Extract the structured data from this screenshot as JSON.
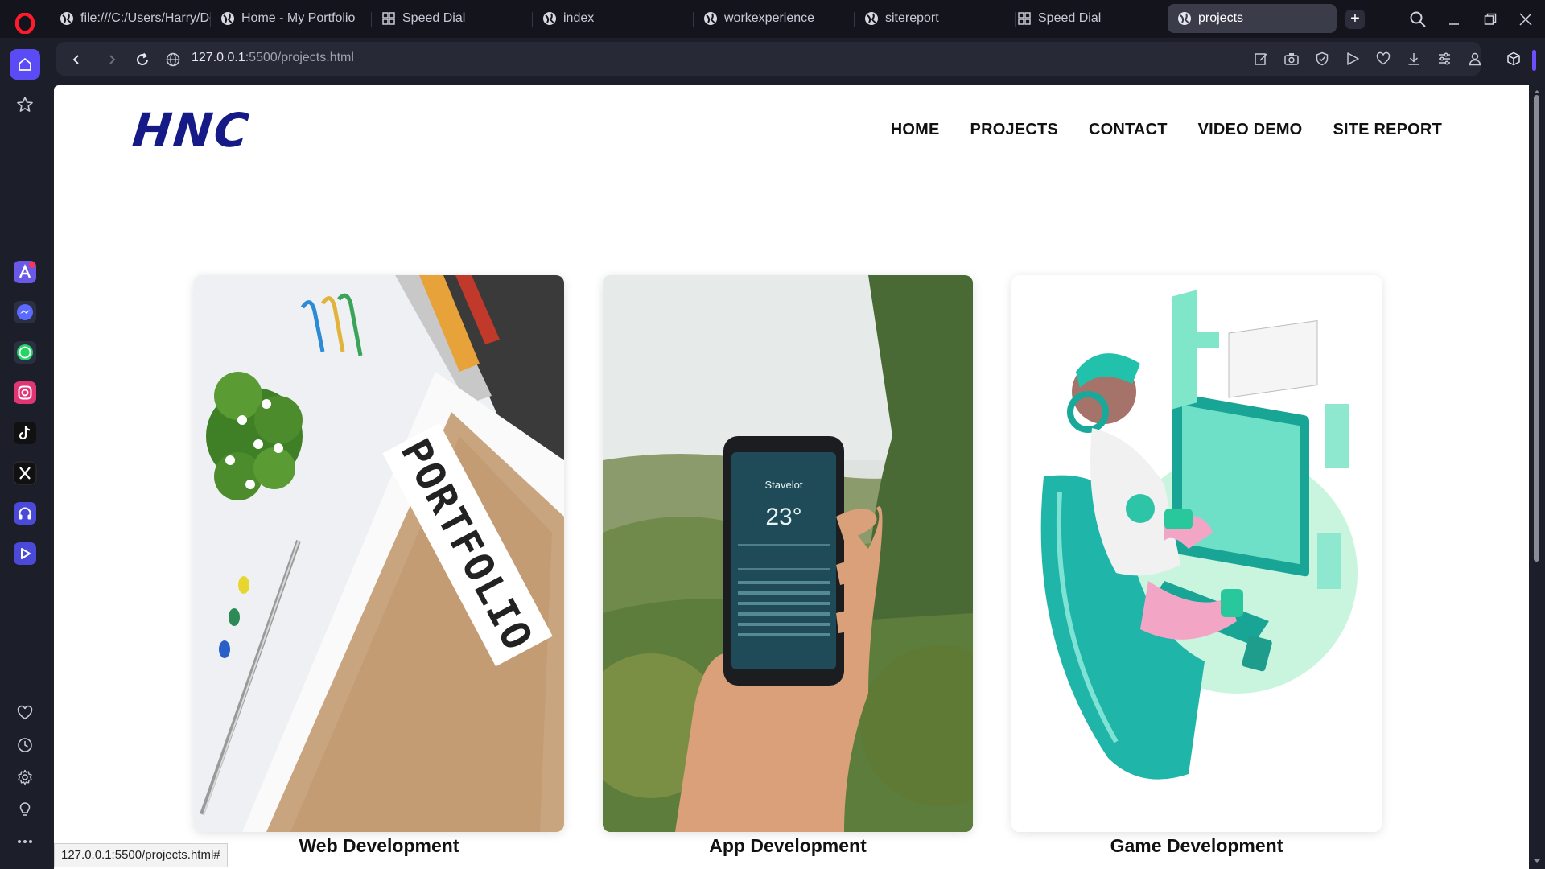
{
  "tabs": [
    {
      "label": "file:///C:/Users/Harry/Do",
      "icon": "globe-icon"
    },
    {
      "label": "Home - My Portfolio",
      "icon": "globe-icon"
    },
    {
      "label": "Speed Dial",
      "icon": "speed-dial-icon"
    },
    {
      "label": "index",
      "icon": "globe-icon"
    },
    {
      "label": "workexperience",
      "icon": "globe-icon"
    },
    {
      "label": "sitereport",
      "icon": "globe-icon"
    },
    {
      "label": "Speed Dial",
      "icon": "speed-dial-icon"
    },
    {
      "label": "projects",
      "icon": "globe-icon",
      "active": true
    }
  ],
  "address": {
    "host": "127.0.0.1",
    "rest": ":5500/projects.html"
  },
  "site": {
    "logo": "HNC",
    "nav": [
      "HOME",
      "PROJECTS",
      "CONTACT",
      "VIDEO DEMO",
      "SITE REPORT"
    ]
  },
  "projects": [
    {
      "title": "Web Development",
      "image": "portfolio-folder"
    },
    {
      "title": "App Development",
      "image": "hand-holding-phone"
    },
    {
      "title": "Game Development",
      "image": "game-developer-illustration"
    }
  ],
  "phone_screen": {
    "city": "Stavelot",
    "temp": "23°"
  },
  "folder_label": "PORTFOLIO",
  "status_url": "127.0.0.1:5500/projects.html#",
  "colors": {
    "brand": "#151a86",
    "browser_bg": "#1c1e2a",
    "accent": "#6b4fff"
  }
}
